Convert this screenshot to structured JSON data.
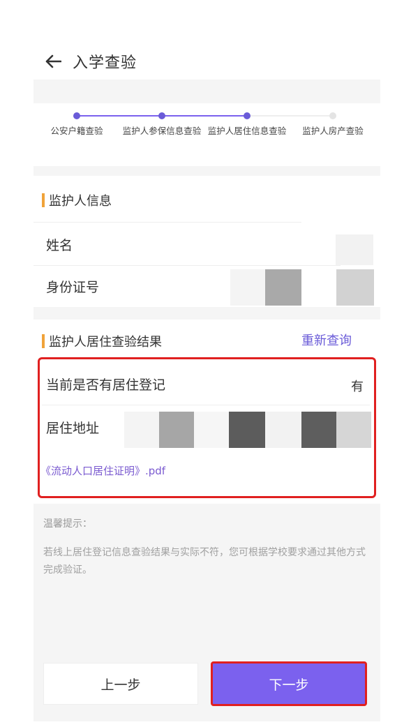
{
  "header": {
    "title": "入学查验",
    "back_icon": "arrow-left-icon"
  },
  "steps": [
    {
      "label": "公安户籍查验",
      "state": "done"
    },
    {
      "label": "监护人参保信息查验",
      "state": "done"
    },
    {
      "label": "监护人居住信息查验",
      "state": "current"
    },
    {
      "label": "监护人房产查验",
      "state": "pending"
    }
  ],
  "colors": {
    "accent": "#7b61ee",
    "step_active": "#6a5bd8",
    "section_bar": "#f0a33a",
    "highlight": "#e02020"
  },
  "guardian_info": {
    "title": "监护人信息",
    "fields": [
      {
        "label": "姓名",
        "value_state": "masked"
      },
      {
        "label": "身份证号",
        "value_state": "masked"
      }
    ]
  },
  "residence_result": {
    "title": "监护人居住查验结果",
    "requery_label": "重新查询",
    "has_registration_label": "当前是否有居住登记",
    "has_registration_value": "有",
    "address_label": "居住地址",
    "certificate_link": "《流动人口居住证明》.pdf"
  },
  "tips": {
    "title": "温馨提示：",
    "text": "若线上居住登记信息查验结果与实际不符，您可根据学校要求通过其他方式完成验证。"
  },
  "footer": {
    "prev_label": "上一步",
    "next_label": "下一步"
  }
}
